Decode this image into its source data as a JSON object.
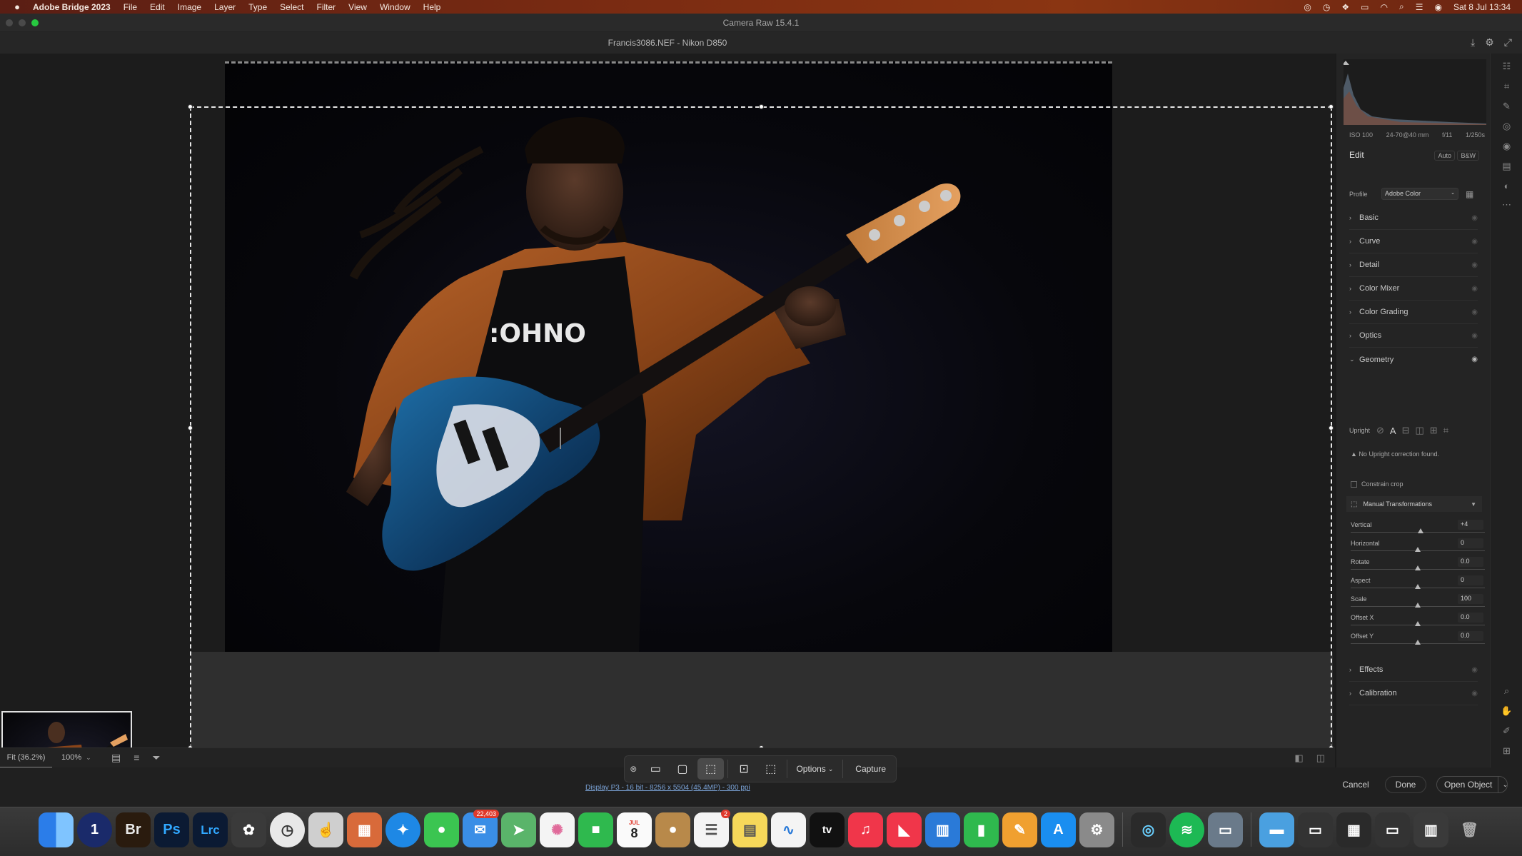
{
  "menubar": {
    "app_name": "Adobe Bridge 2023",
    "items": [
      "File",
      "Edit",
      "Image",
      "Layer",
      "Type",
      "Select",
      "Filter",
      "View",
      "Window",
      "Help"
    ],
    "clock": "Sat 8 Jul  13:34"
  },
  "window": {
    "title": "Camera Raw 15.4.1"
  },
  "file": {
    "title": "Francis3086.NEF  -  Nikon D850"
  },
  "canvas": {
    "zoom_fit_label": "Fit (36.2%)",
    "zoom_value": "100%",
    "status_link": "Display P3 - 16 bit - 8256 x 5504 (45.4MP) - 300 ppi"
  },
  "capture_toolbar": {
    "options_label": "Options",
    "capture_label": "Capture"
  },
  "footer_buttons": {
    "cancel": "Cancel",
    "done": "Done",
    "open": "Open Object"
  },
  "panel": {
    "camera_info": [
      "ISO 100",
      "24-70@40 mm",
      "f/11",
      "1/250s"
    ],
    "edit_title": "Edit",
    "auto_label": "Auto",
    "bw_label": "B&W",
    "profile_label": "Profile",
    "profile_value": "Adobe Color",
    "sections_top": [
      "Basic",
      "Curve",
      "Detail",
      "Color Mixer",
      "Color Grading",
      "Optics"
    ],
    "geometry_title": "Geometry",
    "upright_label": "Upright",
    "upright_warning": "No Upright correction found.",
    "constrain_label": "Constrain crop",
    "manual_title": "Manual Transformations",
    "sliders": [
      {
        "label": "Vertical",
        "value": "+4",
        "position": 0.52
      },
      {
        "label": "Horizontal",
        "value": "0",
        "position": 0.5
      },
      {
        "label": "Rotate",
        "value": "0.0",
        "position": 0.5
      },
      {
        "label": "Aspect",
        "value": "0",
        "position": 0.5
      },
      {
        "label": "Scale",
        "value": "100",
        "position": 0.5
      },
      {
        "label": "Offset X",
        "value": "0.0",
        "position": 0.5
      },
      {
        "label": "Offset Y",
        "value": "0.0",
        "position": 0.5
      }
    ],
    "sections_bottom": [
      "Effects",
      "Calibration"
    ]
  },
  "dock": {
    "mail_badge": "22,403",
    "calendar_month": "JUL",
    "calendar_day": "8",
    "reminders_badge": "2",
    "apps": [
      {
        "label": "",
        "icon": "finder-icon",
        "color": "#2b7de9"
      },
      {
        "label": "1",
        "icon": "1password-icon",
        "color": "#1a2a6a"
      },
      {
        "label": "Br",
        "icon": "bridge-icon",
        "color": "#2a1b0e"
      },
      {
        "label": "Ps",
        "icon": "photoshop-icon",
        "color": "#0b1a33"
      },
      {
        "label": "Lrc",
        "icon": "lightroom-icon",
        "color": "#0b1a33"
      }
    ]
  },
  "colors": {
    "accent": "#7aa2d6",
    "selection": "#e6e6e6",
    "menubar": "#7a2b12"
  }
}
